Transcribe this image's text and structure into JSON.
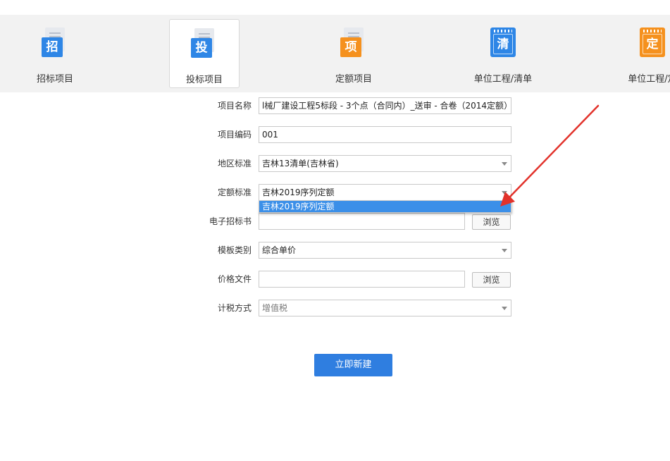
{
  "tabs": [
    {
      "label": "招标项目",
      "icon": "招",
      "icon_name": "tender-doc-icon",
      "color": "#2e86e6"
    },
    {
      "label": "投标项目",
      "icon": "投",
      "icon_name": "bid-doc-icon",
      "color": "#2e86e6",
      "active": true
    },
    {
      "label": "定额项目",
      "icon": "项",
      "icon_name": "quota-doc-icon",
      "color": "#f5911e"
    },
    {
      "label": "单位工程/清单",
      "icon": "清",
      "icon_name": "bill-notepad-icon",
      "color": "#2e86e6"
    },
    {
      "label": "单位工程/定",
      "icon": "定",
      "icon_name": "quota-notepad-icon",
      "color": "#f5911e"
    }
  ],
  "form": {
    "project_name": {
      "label": "项目名称",
      "value": "l械厂建设工程5标段 - 3个点（合同内）_送审 - 合卷（2014定额）"
    },
    "project_code": {
      "label": "项目编码",
      "value": "001"
    },
    "region_standard": {
      "label": "地区标准",
      "value": "吉林13清单(吉林省)"
    },
    "quota_standard": {
      "label": "定额标准",
      "value": "吉林2019序列定额",
      "dropdown_options": [
        "吉林2019序列定额"
      ]
    },
    "e_tender": {
      "label": "电子招标书",
      "value": "",
      "browse_label": "浏览"
    },
    "template_type": {
      "label": "模板类别",
      "value": "综合单价"
    },
    "price_file": {
      "label": "价格文件",
      "value": "",
      "browse_label": "浏览"
    },
    "tax_method": {
      "label": "计税方式",
      "value": "增值税"
    }
  },
  "create_button": "立即新建",
  "colors": {
    "accent": "#2f7ee0",
    "annotation_arrow": "#e2322b",
    "dropdown_highlight": "#3b8fe8"
  }
}
